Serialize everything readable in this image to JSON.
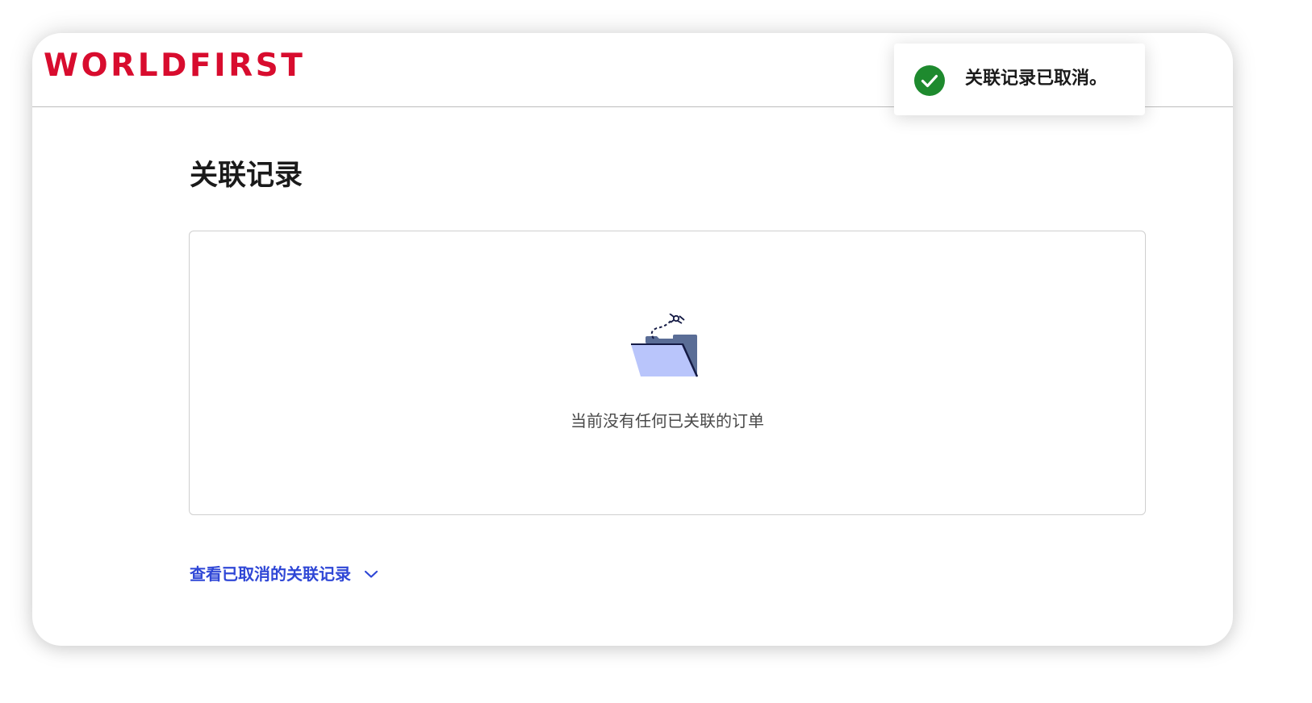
{
  "brand": {
    "logo_text": "WORLDFIRST",
    "color": "#d80c2e"
  },
  "page": {
    "title": "关联记录"
  },
  "records": {
    "empty_icon": "empty-folder-icon",
    "empty_message": "当前没有任何已关联的订单"
  },
  "cancelled_link": {
    "label": "查看已取消的关联记录",
    "icon": "chevron-down-icon",
    "color": "#2f47d6"
  },
  "toast": {
    "icon": "check-circle-icon",
    "message": "关联记录已取消。",
    "status_color": "#1e8a2e"
  }
}
